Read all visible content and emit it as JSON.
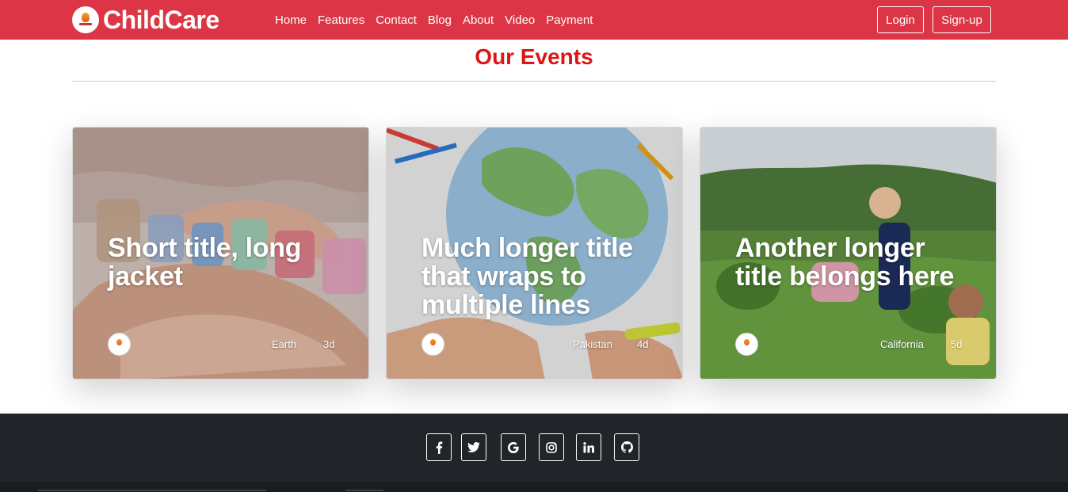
{
  "navbar": {
    "brand": "ChildCare",
    "links": [
      "Home",
      "Features",
      "Contact",
      "Blog",
      "About",
      "Video",
      "Payment"
    ],
    "login_label": "Login",
    "signup_label": "Sign-up",
    "color": "#dc3545"
  },
  "events": {
    "title": "Our Events",
    "title_color": "#dc1616",
    "cards": [
      {
        "title": "Short title, long jacket",
        "place": "Earth",
        "days": "3d",
        "image": "hands-donate-photo"
      },
      {
        "title": "Much longer title that wraps to multiple lines",
        "place": "Pakistan",
        "days": "4d",
        "image": "kids-drawing-globe-photo"
      },
      {
        "title": "Another longer title belongs here",
        "place": "California",
        "days": "5d",
        "image": "kids-in-garden-photo"
      }
    ]
  },
  "footer": {
    "background": "#212529",
    "social_icons": [
      "facebook-icon",
      "twitter-icon",
      "google-icon",
      "instagram-icon",
      "linkedin-icon",
      "github-icon"
    ]
  }
}
